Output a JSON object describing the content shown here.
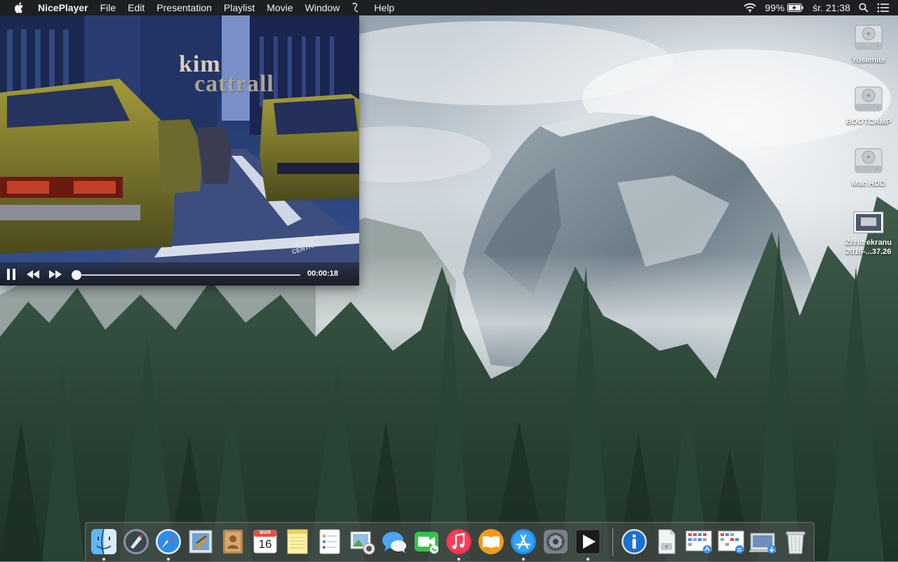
{
  "menubar": {
    "app_name": "NicePlayer",
    "menus": [
      "File",
      "Edit",
      "Presentation",
      "Playlist",
      "Movie",
      "Window",
      "Help"
    ],
    "battery_percent": "99%",
    "clock": "śr. 21:38"
  },
  "player": {
    "video_title_line1": "kim",
    "video_title_line2": "cattrall",
    "watermark_line1": "COMEDY",
    "watermark_line2": "CENTRAL",
    "elapsed_time": "00:00:18",
    "progress_fraction": 0.01,
    "state": "playing"
  },
  "desktop": {
    "icons": [
      {
        "label": "Yosemite",
        "icon": "hard-drive-icon"
      },
      {
        "label": "BOOTCAMP",
        "icon": "hard-drive-icon"
      },
      {
        "label": "Mac HDD",
        "icon": "hard-drive-icon"
      },
      {
        "label_line1": "Zrzut ekranu",
        "label_line2": "2016-...37.26",
        "icon": "screenshot-file-icon"
      }
    ]
  },
  "dock": {
    "apps": [
      {
        "name": "Finder",
        "icon": "finder-icon",
        "running": true
      },
      {
        "name": "Launchpad",
        "icon": "launchpad-icon",
        "running": false
      },
      {
        "name": "Safari",
        "icon": "safari-icon",
        "running": true
      },
      {
        "name": "Mail",
        "icon": "mail-icon",
        "running": false
      },
      {
        "name": "Contacts",
        "icon": "contacts-icon",
        "running": false
      },
      {
        "name": "Calendar",
        "icon": "calendar-icon",
        "running": false,
        "month": "MAR",
        "day": "16"
      },
      {
        "name": "Notes",
        "icon": "notes-icon",
        "running": false
      },
      {
        "name": "Reminders",
        "icon": "reminders-icon",
        "running": false
      },
      {
        "name": "Photo Booth",
        "icon": "photos-icon",
        "running": false
      },
      {
        "name": "Messages",
        "icon": "messages-icon",
        "running": false
      },
      {
        "name": "FaceTime",
        "icon": "facetime-icon",
        "running": false
      },
      {
        "name": "iTunes",
        "icon": "itunes-icon",
        "running": true
      },
      {
        "name": "iBooks",
        "icon": "ibooks-icon",
        "running": false
      },
      {
        "name": "App Store",
        "icon": "app-store-icon",
        "running": true
      },
      {
        "name": "System Preferences",
        "icon": "system-preferences-icon",
        "running": false
      },
      {
        "name": "NicePlayer",
        "icon": "niceplayer-icon",
        "running": true
      },
      {
        "name": "Info",
        "icon": "info-icon",
        "running": false
      },
      {
        "name": "Document",
        "icon": "document-icon",
        "running": false
      },
      {
        "name": "Applications",
        "icon": "applications-folder-icon",
        "running": false
      },
      {
        "name": "Documents",
        "icon": "documents-folder-icon",
        "running": false
      },
      {
        "name": "Downloads",
        "icon": "downloads-folder-icon",
        "running": false
      },
      {
        "name": "Trash",
        "icon": "trash-icon",
        "running": false
      }
    ]
  }
}
